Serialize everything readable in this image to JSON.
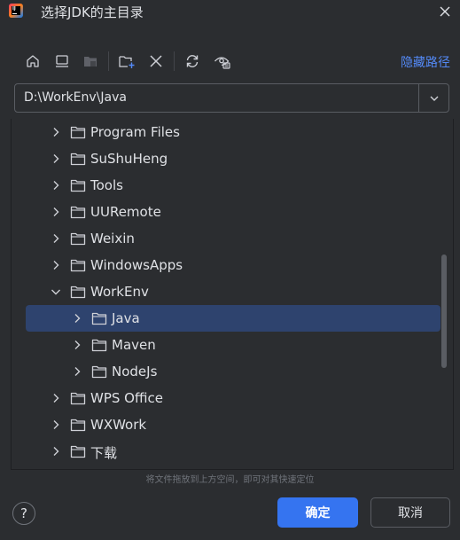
{
  "window": {
    "title": "选择JDK的主目录"
  },
  "toolbar": {
    "buttons": [
      {
        "name": "home-icon",
        "enabled": true
      },
      {
        "name": "desktop-icon",
        "enabled": true
      },
      {
        "name": "project-folder-icon",
        "enabled": false
      },
      {
        "name": "new-folder-icon",
        "enabled": true
      },
      {
        "name": "delete-icon",
        "enabled": true
      },
      {
        "name": "refresh-icon",
        "enabled": true
      },
      {
        "name": "show-hidden-icon",
        "enabled": true
      }
    ],
    "path_toggle_label": "隐藏路径"
  },
  "path": {
    "value": "D:\\WorkEnv\\Java"
  },
  "tree": {
    "items": [
      {
        "label": "Program Files",
        "level": 0,
        "expanded": false,
        "selected": false
      },
      {
        "label": "SuShuHeng",
        "level": 0,
        "expanded": false,
        "selected": false
      },
      {
        "label": "Tools",
        "level": 0,
        "expanded": false,
        "selected": false
      },
      {
        "label": "UURemote",
        "level": 0,
        "expanded": false,
        "selected": false
      },
      {
        "label": "Weixin",
        "level": 0,
        "expanded": false,
        "selected": false
      },
      {
        "label": "WindowsApps",
        "level": 0,
        "expanded": false,
        "selected": false
      },
      {
        "label": "WorkEnv",
        "level": 0,
        "expanded": true,
        "selected": false
      },
      {
        "label": "Java",
        "level": 1,
        "expanded": false,
        "selected": true
      },
      {
        "label": "Maven",
        "level": 1,
        "expanded": false,
        "selected": false
      },
      {
        "label": "NodeJs",
        "level": 1,
        "expanded": false,
        "selected": false
      },
      {
        "label": "WPS Office",
        "level": 0,
        "expanded": false,
        "selected": false
      },
      {
        "label": "WXWork",
        "level": 0,
        "expanded": false,
        "selected": false
      },
      {
        "label": "下载",
        "level": 0,
        "expanded": false,
        "selected": false
      }
    ]
  },
  "hint": "将文件拖放到上方空间，即可对其快速定位",
  "footer": {
    "help_label": "?",
    "ok_label": "确定",
    "cancel_label": "取消"
  },
  "colors": {
    "background": "#2b2d30",
    "selection": "#2e436e",
    "accent": "#3574f0",
    "link": "#548af7"
  }
}
